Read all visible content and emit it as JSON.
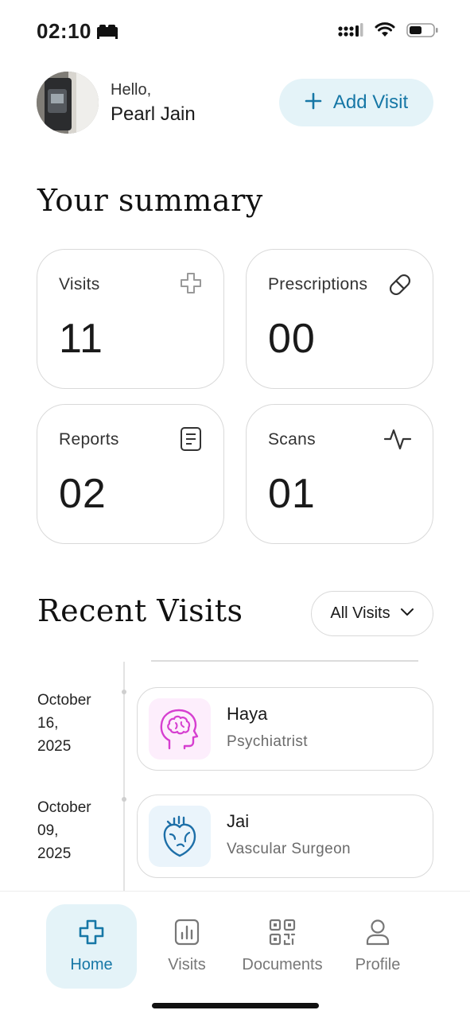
{
  "status_bar": {
    "time": "02:10"
  },
  "header": {
    "greeting": "Hello,",
    "user_name": "Pearl Jain",
    "add_visit_label": "Add Visit"
  },
  "summary": {
    "title": "Your summary",
    "cards": [
      {
        "label": "Visits",
        "value": "11",
        "icon": "medical-cross-icon"
      },
      {
        "label": "Prescriptions",
        "value": "00",
        "icon": "pill-icon"
      },
      {
        "label": "Reports",
        "value": "02",
        "icon": "document-icon"
      },
      {
        "label": "Scans",
        "value": "01",
        "icon": "pulse-icon"
      }
    ]
  },
  "recent_visits": {
    "title": "Recent Visits",
    "filter_label": "All Visits",
    "items": [
      {
        "date_month": "October",
        "date_day": "16,",
        "date_year": "2025",
        "name": "Haya",
        "specialty": "Psychiatrist",
        "icon": "brain-icon",
        "accent": "#d63fd0",
        "icon_bg": "#fdeefc"
      },
      {
        "date_month": "October",
        "date_day": "09,",
        "date_year": "2025",
        "name": "Jai",
        "specialty": "Vascular Surgeon",
        "icon": "heart-anatomy-icon",
        "accent": "#1d6fa8",
        "icon_bg": "#eaf4fb"
      }
    ]
  },
  "bottom_nav": {
    "items": [
      {
        "label": "Home",
        "icon": "medical-cross-icon",
        "active": true
      },
      {
        "label": "Visits",
        "icon": "bar-chart-icon",
        "active": false
      },
      {
        "label": "Documents",
        "icon": "qr-code-icon",
        "active": false
      },
      {
        "label": "Profile",
        "icon": "person-icon",
        "active": false
      }
    ]
  },
  "colors": {
    "accent": "#1677a6",
    "accent_bg": "#e4f3f8",
    "card_border": "#d9d9d9"
  }
}
